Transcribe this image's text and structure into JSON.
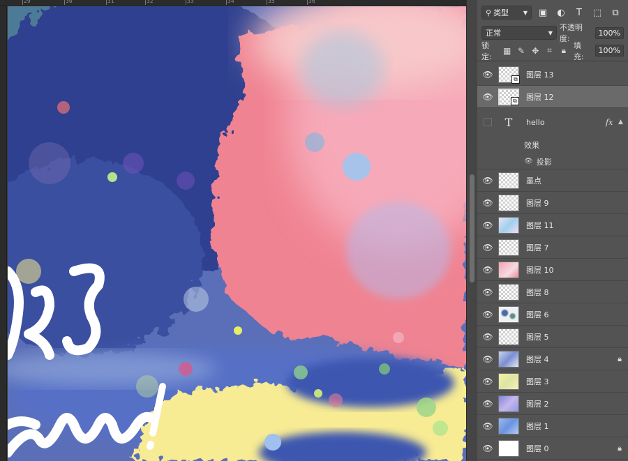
{
  "ruler": {
    "labels": [
      "29",
      "30",
      "31",
      "32",
      "33",
      "34",
      "35",
      "36"
    ]
  },
  "panel": {
    "filter_label": "类型",
    "blend_mode": "正常",
    "opacity_label": "不透明度:",
    "opacity_value": "100%",
    "lock_label": "锁定:",
    "fill_label": "填充:",
    "fill_value": "100%"
  },
  "layers": {
    "l13": "图层 13",
    "l12": "图层 12",
    "text_layer": "hello",
    "effects_label": "效果",
    "drop_shadow_label": "投影",
    "ink": "墨点",
    "l9": "图层 9",
    "l11": "图层 11",
    "l7": "图层 7",
    "l10": "图层 10",
    "l8": "图层 8",
    "l6": "图层 6",
    "l5": "图层 5",
    "l4": "图层 4",
    "l3": "图层 3",
    "l2": "图层 2",
    "l1": "图层 1",
    "l0": "图层 0"
  },
  "icons": {
    "eye": "eye-icon",
    "lock": "lock-icon",
    "text": "text-type-icon"
  },
  "colors": {
    "panel_bg": "#535353",
    "selected_row": "#6a6a6a",
    "art_navy": "#2f3f8f",
    "art_pink": "#f18a98",
    "art_yellow": "#f7eb93"
  }
}
